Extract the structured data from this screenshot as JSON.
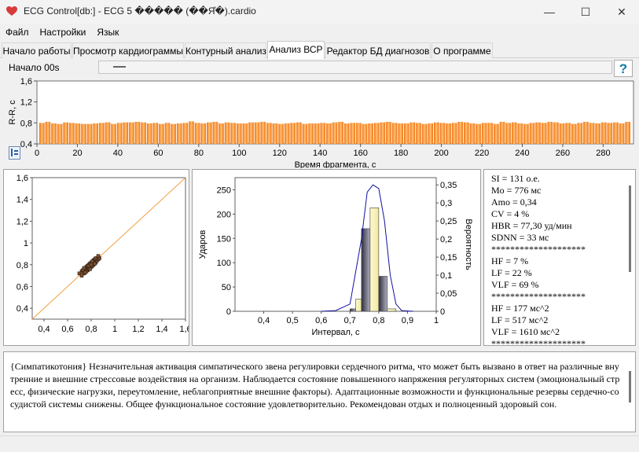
{
  "window": {
    "title": "ECG Control[db:] - ECG 5 ����� (��Я̊�).cardio",
    "minimize_glyph": "—",
    "maximize_glyph": "☐",
    "close_glyph": "✕"
  },
  "menu": [
    {
      "label": "Файл"
    },
    {
      "label": "Настройки"
    },
    {
      "label": "Язык"
    }
  ],
  "tabs": [
    {
      "label": "Начало работы"
    },
    {
      "label": "Просмотр кардиограммы"
    },
    {
      "label": "Контурный анализ"
    },
    {
      "label": "Анализ ВСР",
      "active": true
    },
    {
      "label": "Редактор БД диагнозов"
    },
    {
      "label": "О программе"
    }
  ],
  "top": {
    "start_label": "Начало  00s",
    "slider_position": 0,
    "help_glyph": "?"
  },
  "colors": {
    "bar_orange": "#f07010",
    "bar_light": "#ffc070",
    "scatter_line": "#f0a040",
    "hist_curve": "#1010a0",
    "hist_bar_dark": "#505070",
    "hist_bar_light": "#f0e8a0"
  },
  "icons": {
    "app": "heart-icon",
    "help": "help-icon",
    "settings": "small-settings-icon"
  },
  "chart_data": [
    {
      "type": "bar",
      "ylabel": "R-R, c",
      "xlabel": "Время фрагмента, с",
      "xlim": [
        0,
        295
      ],
      "ylim": [
        0.4,
        1.6
      ],
      "x_ticks": [
        "0",
        "20",
        "40",
        "60",
        "80",
        "100",
        "120",
        "140",
        "160",
        "180",
        "200",
        "220",
        "240",
        "260",
        "280"
      ],
      "y_ticks": [
        "0,4",
        "0,8",
        "1,2",
        "1,6"
      ],
      "y_minor_ticks": [
        "0,8",
        "1,2",
        "1,6"
      ],
      "bar_width": 3,
      "values": [
        0.8,
        0.82,
        0.79,
        0.78,
        0.81,
        0.8,
        0.79,
        0.78,
        0.78,
        0.79,
        0.8,
        0.81,
        0.78,
        0.8,
        0.81,
        0.81,
        0.82,
        0.81,
        0.79,
        0.8,
        0.78,
        0.8,
        0.78,
        0.79,
        0.8,
        0.83,
        0.8,
        0.79,
        0.81,
        0.82,
        0.79,
        0.81,
        0.8,
        0.79,
        0.79,
        0.81,
        0.81,
        0.82,
        0.8,
        0.79,
        0.78,
        0.79,
        0.8,
        0.81,
        0.78,
        0.79,
        0.79,
        0.8,
        0.79,
        0.81,
        0.82,
        0.79,
        0.8,
        0.8,
        0.78,
        0.79,
        0.8,
        0.81,
        0.82,
        0.8,
        0.79,
        0.79,
        0.81,
        0.8,
        0.78,
        0.79,
        0.81,
        0.8,
        0.79,
        0.8,
        0.82,
        0.81,
        0.79,
        0.78,
        0.8,
        0.8,
        0.78,
        0.82,
        0.8,
        0.81,
        0.79,
        0.78,
        0.8,
        0.81,
        0.8,
        0.82,
        0.81,
        0.79,
        0.8,
        0.78,
        0.8,
        0.82,
        0.8,
        0.79,
        0.81,
        0.8,
        0.81,
        0.79,
        0.82
      ],
      "grid": false
    },
    {
      "type": "scatter",
      "xlabel": "",
      "ylabel": "",
      "xlim": [
        0.3,
        1.6
      ],
      "ylim": [
        0.3,
        1.6
      ],
      "x_ticks": [
        "0,4",
        "0,6",
        "0,8",
        "1",
        "1,2",
        "1,4",
        "1,6"
      ],
      "y_ticks": [
        "0,4",
        "0,6",
        "0,8",
        "1",
        "1,2",
        "1,4",
        "1,6"
      ],
      "identity_line": true,
      "points": [
        [
          0.72,
          0.74
        ],
        [
          0.74,
          0.72
        ],
        [
          0.76,
          0.78
        ],
        [
          0.78,
          0.8
        ],
        [
          0.8,
          0.78
        ],
        [
          0.82,
          0.84
        ],
        [
          0.84,
          0.82
        ],
        [
          0.75,
          0.76
        ],
        [
          0.77,
          0.75
        ],
        [
          0.79,
          0.81
        ],
        [
          0.81,
          0.79
        ],
        [
          0.83,
          0.85
        ],
        [
          0.85,
          0.84
        ],
        [
          0.73,
          0.75
        ],
        [
          0.76,
          0.74
        ],
        [
          0.78,
          0.77
        ],
        [
          0.8,
          0.82
        ],
        [
          0.82,
          0.8
        ],
        [
          0.84,
          0.86
        ],
        [
          0.86,
          0.85
        ],
        [
          0.74,
          0.77
        ],
        [
          0.77,
          0.79
        ],
        [
          0.79,
          0.76
        ],
        [
          0.81,
          0.83
        ],
        [
          0.83,
          0.81
        ],
        [
          0.7,
          0.72
        ],
        [
          0.72,
          0.7
        ],
        [
          0.87,
          0.86
        ],
        [
          0.86,
          0.88
        ],
        [
          0.75,
          0.73
        ],
        [
          0.78,
          0.79
        ],
        [
          0.8,
          0.8
        ]
      ]
    },
    {
      "type": "bar",
      "xlabel": "Интервал, с",
      "ylabel": "Ударов",
      "y2label": "Вероятность",
      "xlim": [
        0.3,
        1.0
      ],
      "ylim": [
        0,
        275
      ],
      "y2lim": [
        0,
        0.37
      ],
      "x_ticks": [
        "0,4",
        "0,5",
        "0,6",
        "0,7",
        "0,8",
        "0,9",
        "1"
      ],
      "y_ticks": [
        "0",
        "50",
        "100",
        "150",
        "200",
        "250"
      ],
      "y2_ticks": [
        "0",
        "0,05",
        "0,1",
        "0,15",
        "0,2",
        "0,25",
        "0,3",
        "0,35"
      ],
      "bars": [
        {
          "x0": 0.7,
          "x1": 0.72,
          "value": 5
        },
        {
          "x0": 0.72,
          "x1": 0.74,
          "value": 25
        },
        {
          "x0": 0.74,
          "x1": 0.77,
          "value": 170
        },
        {
          "x0": 0.77,
          "x1": 0.8,
          "value": 213
        },
        {
          "x0": 0.8,
          "x1": 0.83,
          "value": 72
        },
        {
          "x0": 0.83,
          "x1": 0.86,
          "value": 5
        }
      ],
      "curve": [
        [
          0.6,
          0
        ],
        [
          0.65,
          0.002
        ],
        [
          0.7,
          0.02
        ],
        [
          0.74,
          0.2
        ],
        [
          0.76,
          0.33
        ],
        [
          0.78,
          0.35
        ],
        [
          0.8,
          0.34
        ],
        [
          0.82,
          0.25
        ],
        [
          0.84,
          0.1
        ],
        [
          0.86,
          0.02
        ],
        [
          0.88,
          0.002
        ],
        [
          0.92,
          0
        ]
      ]
    }
  ],
  "stats": [
    "SI = 131 о.е.",
    "Mo = 776 мс",
    "Amo = 0,34",
    "CV = 4 %",
    "HBR = 77,30 уд/мин",
    "SDNN = 33 мс",
    " ********************",
    "HF = 7 %",
    "LF = 22 %",
    "VLF = 69 %",
    " ********************",
    "HF = 177 мс^2",
    "LF = 517 мс^2",
    "VLF = 1610 мс^2",
    " ********************"
  ],
  "report": "{Симпатикотония} Незначительная активация симпатического звена регулировки сердечного ритма, что может быть вызвано в ответ на различные внутренние и внешние стрессовые воздействия на организм.  Наблюдается состояние повышенного напряжения регуляторных систем (эмоциональный стресс, физические нагрузки, переутомление, неблагоприятные внешние факторы).  Адаптационные возможности и функциональные резервы сердечно-сосудистой системы снижены. Общее функциональное состояние удовлетворительно. Рекомендован отдых и полноценный здоровый сон."
}
